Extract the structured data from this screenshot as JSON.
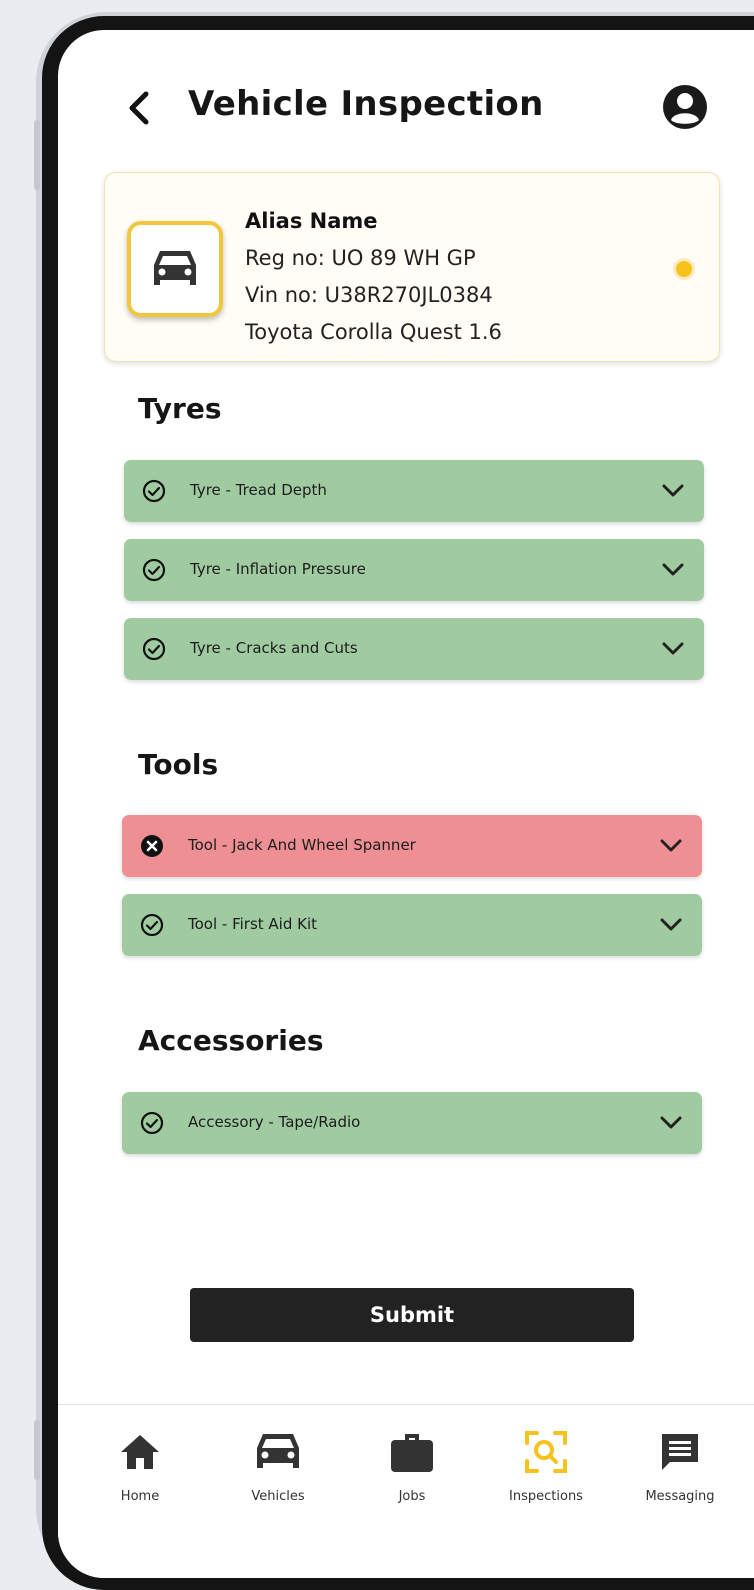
{
  "header": {
    "title": "Vehicle Inspection"
  },
  "vehicle": {
    "alias": "Alias Name",
    "reg": "Reg no: UO 89 WH GP",
    "vin": "Vin no: U38R270JL0384",
    "model": "Toyota Corolla Quest 1.6",
    "selected": true
  },
  "sections": {
    "tyres": {
      "title": "Tyres",
      "items": [
        {
          "label": "Tyre - Tread Depth",
          "status": "pass"
        },
        {
          "label": "Tyre - Inflation Pressure",
          "status": "pass"
        },
        {
          "label": "Tyre - Cracks and Cuts",
          "status": "pass"
        }
      ]
    },
    "tools": {
      "title": "Tools",
      "items": [
        {
          "label": "Tool - Jack And Wheel Spanner",
          "status": "fail"
        },
        {
          "label": "Tool - First Aid Kit",
          "status": "pass"
        }
      ]
    },
    "accessories": {
      "title": "Accessories",
      "items": [
        {
          "label": "Accessory - Tape/Radio",
          "status": "pass"
        }
      ]
    }
  },
  "submit_label": "Submit",
  "nav": [
    {
      "label": "Home",
      "icon": "home-icon",
      "active": false
    },
    {
      "label": "Vehicles",
      "icon": "car-icon",
      "active": false
    },
    {
      "label": "Jobs",
      "icon": "briefcase-icon",
      "active": false
    },
    {
      "label": "Inspections",
      "icon": "inspection-search-icon",
      "active": true
    },
    {
      "label": "Messaging",
      "icon": "message-icon",
      "active": false
    }
  ],
  "colors": {
    "accent": "#f7c21b",
    "pass": "#a0cba1",
    "fail": "#ee8f94",
    "primary_button": "#222222"
  }
}
